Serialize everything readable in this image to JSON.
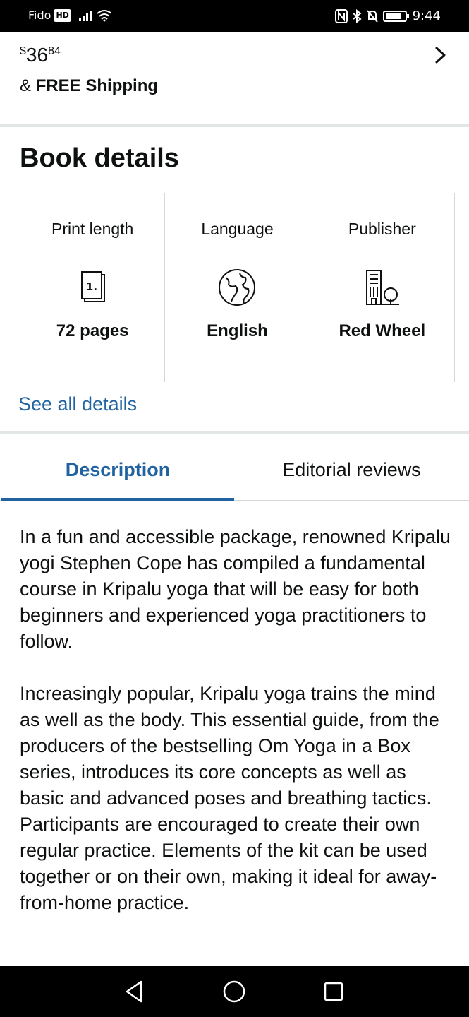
{
  "status_bar": {
    "carrier": "Fido",
    "hd_badge": "HD",
    "time": "9:44"
  },
  "price": {
    "currency_symbol": "$",
    "whole": "36",
    "fraction": "84",
    "shipping_prefix": "&",
    "shipping_label": "FREE Shipping"
  },
  "book_details": {
    "title": "Book details",
    "items": [
      {
        "label": "Print length",
        "value": "72 pages",
        "icon": "page-count-icon",
        "icon_text": "1."
      },
      {
        "label": "Language",
        "value": "English",
        "icon": "globe-icon"
      },
      {
        "label": "Publisher",
        "value": "Red Wheel",
        "icon": "building-tree-icon"
      }
    ],
    "see_all_label": "See all details"
  },
  "tabs": {
    "description_label": "Description",
    "editorial_label": "Editorial reviews",
    "active": "Description"
  },
  "description": {
    "paragraphs": [
      "In a fun and accessible package, renowned Kripalu yogi Stephen Cope has compiled a fundamental course in Kripalu yoga that will be easy for both beginners and experienced yoga practitioners to follow.",
      "Increasingly popular, Kripalu yoga trains the mind as well as the body. This essential guide, from the producers of the bestselling Om Yoga in a Box series, introduces its core concepts as well as basic and advanced poses and breathing tactics. Participants are encouraged to create their own regular practice. Elements of the kit can be used together or on their own, making it ideal for away-from-home practice."
    ]
  },
  "colors": {
    "link": "#2162a1",
    "text": "#0f1111",
    "divider": "#e3e6e6"
  },
  "battery_level": 0.7
}
